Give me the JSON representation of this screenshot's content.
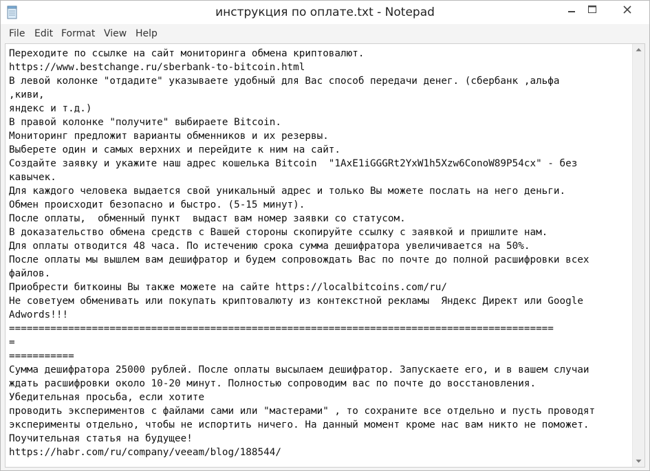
{
  "window": {
    "title": "инструкция по оплате.txt - Notepad"
  },
  "menu": {
    "items": [
      {
        "label": "File"
      },
      {
        "label": "Edit"
      },
      {
        "label": "Format"
      },
      {
        "label": "View"
      },
      {
        "label": "Help"
      }
    ]
  },
  "document": {
    "lines": [
      "Переходите по ссылке на сайт мониторинга обмена криптовалют.",
      "https://www.bestchange.ru/sberbank-to-bitcoin.html",
      "В левой колонке \"отдадите\" указываете удобный для Вас способ передачи денег. (сбербанк ,альфа",
      ",киви,",
      "яндекс и т.д.)",
      "В правой колонке \"получите\" выбираете Bitcoin.",
      "Мониторинг предложит варианты обменников и их резервы.",
      "Выберете один и самых верхних и перейдите к ним на сайт.",
      "Создайте заявку и укажите наш адрес кошелька Bitcoin  \"1AxE1iGGGRt2YxW1h5Xzw6ConoW89P54cx\" - без",
      "кавычек.",
      "Для каждого человека выдается свой уникальный адрес и только Вы можете послать на него деньги.",
      "Обмен происходит безопасно и быстро. (5-15 минут).",
      "После оплаты,  обменный пункт  выдаст вам номер заявки со статусом.",
      "В доказательство обмена средств с Вашей стороны скопируйте ссылку с заявкой и пришлите нам.",
      "Для оплаты отводится 48 часа. По истечению срока сумма дешифратора увеличивается на 50%.",
      "После оплаты мы вышлем вам дешифратор и будем сопровождать Вас по почте до полной расшифровки всех",
      "файлов.",
      "Приобрести биткоины Вы также можете на сайте https://localbitcoins.com/ru/",
      "Не советуем обменивать или покупать криптовалюту из контекстной рекламы  Яндекс Директ или Google",
      "Adwords!!!",
      "============================================================================================",
      "=",
      "===========",
      "Сумма дешифратора 25000 рублей. После оплаты высылаем дешифратор. Запускаете его, и в вашем случаи",
      "ждать расшифровки около 10-20 минут. Полностью сопроводим вас по почте до восстановления.",
      "Убедительная просьба, если хотите",
      "проводить экспериментов с файлами сами или \"мастерами\" , то сохраните все отдельно и пусть проводят",
      "эксперименты отдельно, чтобы не испортить ничего. На данный момент кроме нас вам никто не поможет.",
      "Поучительная статья на будущее!",
      "https://habr.com/ru/company/veeam/blog/188544/"
    ]
  },
  "colors": {
    "titlebar_bg": "#ffffff",
    "frame_bg": "#f4f4f4",
    "editor_bg": "#ffffff",
    "text": "#111111"
  }
}
